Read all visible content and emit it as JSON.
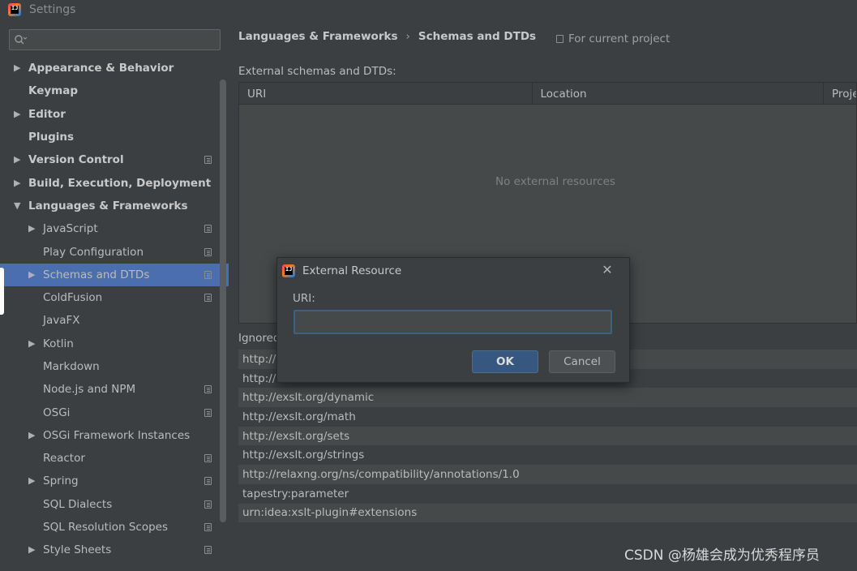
{
  "window": {
    "title": "Settings"
  },
  "search": {
    "placeholder": "",
    "value": ""
  },
  "sidebar": {
    "items": [
      {
        "label": "Appearance & Behavior",
        "level": 0,
        "arrow": "▶",
        "copy": false,
        "selected": false
      },
      {
        "label": "Keymap",
        "level": 0,
        "arrow": "",
        "copy": false,
        "selected": false
      },
      {
        "label": "Editor",
        "level": 0,
        "arrow": "▶",
        "copy": false,
        "selected": false
      },
      {
        "label": "Plugins",
        "level": 0,
        "arrow": "",
        "copy": false,
        "selected": false
      },
      {
        "label": "Version Control",
        "level": 0,
        "arrow": "▶",
        "copy": true,
        "selected": false
      },
      {
        "label": "Build, Execution, Deployment",
        "level": 0,
        "arrow": "▶",
        "copy": false,
        "selected": false
      },
      {
        "label": "Languages & Frameworks",
        "level": 0,
        "arrow": "▼",
        "copy": false,
        "selected": false
      },
      {
        "label": "JavaScript",
        "level": 1,
        "arrow": "▶",
        "copy": true,
        "selected": false
      },
      {
        "label": "Play Configuration",
        "level": 1,
        "arrow": "",
        "copy": true,
        "selected": false
      },
      {
        "label": "Schemas and DTDs",
        "level": 1,
        "arrow": "▶",
        "copy": true,
        "selected": true
      },
      {
        "label": "ColdFusion",
        "level": 1,
        "arrow": "",
        "copy": true,
        "selected": false
      },
      {
        "label": "JavaFX",
        "level": 1,
        "arrow": "",
        "copy": false,
        "selected": false
      },
      {
        "label": "Kotlin",
        "level": 1,
        "arrow": "▶",
        "copy": false,
        "selected": false
      },
      {
        "label": "Markdown",
        "level": 1,
        "arrow": "",
        "copy": false,
        "selected": false
      },
      {
        "label": "Node.js and NPM",
        "level": 1,
        "arrow": "",
        "copy": true,
        "selected": false
      },
      {
        "label": "OSGi",
        "level": 1,
        "arrow": "",
        "copy": true,
        "selected": false
      },
      {
        "label": "OSGi Framework Instances",
        "level": 1,
        "arrow": "▶",
        "copy": false,
        "selected": false
      },
      {
        "label": "Reactor",
        "level": 1,
        "arrow": "",
        "copy": true,
        "selected": false
      },
      {
        "label": "Spring",
        "level": 1,
        "arrow": "▶",
        "copy": true,
        "selected": false
      },
      {
        "label": "SQL Dialects",
        "level": 1,
        "arrow": "",
        "copy": true,
        "selected": false
      },
      {
        "label": "SQL Resolution Scopes",
        "level": 1,
        "arrow": "",
        "copy": true,
        "selected": false
      },
      {
        "label": "Style Sheets",
        "level": 1,
        "arrow": "▶",
        "copy": true,
        "selected": false
      }
    ]
  },
  "main": {
    "breadcrumb": [
      "Languages & Frameworks",
      "Schemas and DTDs"
    ],
    "breadcrumb_separator": "›",
    "scope": "For current project",
    "external_label": "External schemas and DTDs:",
    "table": {
      "columns": [
        "URI",
        "Location",
        "Proje"
      ],
      "empty_text": "No external resources"
    },
    "ignored_label": "Ignored",
    "ignored_rows": [
      "http://",
      "http://",
      "http://exslt.org/dynamic",
      "http://exslt.org/math",
      "http://exslt.org/sets",
      "http://exslt.org/strings",
      "http://relaxng.org/ns/compatibility/annotations/1.0",
      "tapestry:parameter",
      "urn:idea:xslt-plugin#extensions"
    ]
  },
  "dialog": {
    "title": "External Resource",
    "close_glyph": "✕",
    "uri_label": "URI:",
    "uri_value": "",
    "ok_label": "OK",
    "cancel_label": "Cancel"
  },
  "watermark": "CSDN @杨雄会成为优秀程序员",
  "colors": {
    "background": "#3c3f41",
    "selection": "#4b6eaf",
    "ok_button": "#365880",
    "input_focus": "#3d6185"
  }
}
